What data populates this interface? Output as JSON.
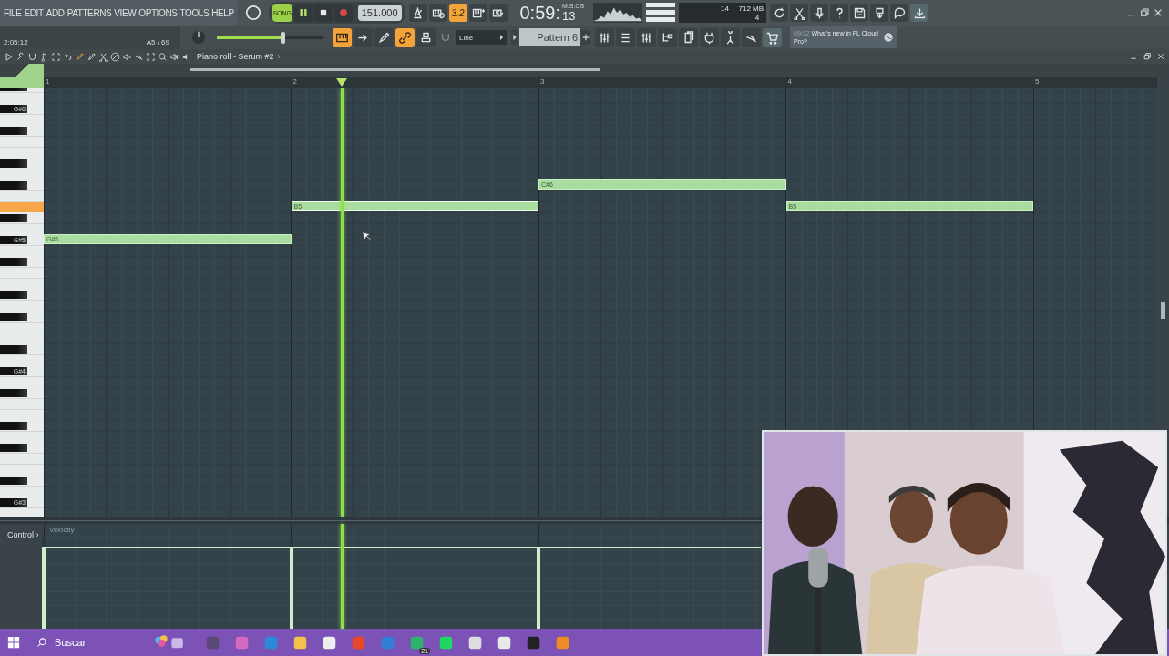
{
  "menu": [
    "FILE",
    "EDIT",
    "ADD",
    "PATTERNS",
    "VIEW",
    "OPTIONS",
    "TOOLS",
    "HELP"
  ],
  "transport": {
    "song": {
      "label": "SONG",
      "selected": true
    },
    "playing": true,
    "recording": false,
    "tempo": "151.000",
    "time": "0:59:",
    "time_cs": "13",
    "time_unit": "M:S:CS"
  },
  "toggles": [
    {
      "kind": "metronome",
      "on": false
    },
    {
      "kind": "wait",
      "on": false
    },
    {
      "kind": "countdown",
      "label": "3.2",
      "on": true
    },
    {
      "kind": "step",
      "on": false
    },
    {
      "kind": "loop",
      "on": false
    }
  ],
  "monitor": {
    "cpu": "14",
    "ram": "712 MB",
    "polyphony": "4"
  },
  "hint_bar": {
    "position": "2:05:12",
    "key": "A5 / 69"
  },
  "master_volume": {
    "level": 0.62
  },
  "tools": [
    {
      "kind": "piano",
      "on": true
    },
    {
      "kind": "arrow",
      "on": false
    },
    {
      "kind": "pencil",
      "on": false
    },
    {
      "kind": "link",
      "on": true
    },
    {
      "kind": "stamp",
      "on": false
    }
  ],
  "snap": {
    "value": "Line"
  },
  "pattern": {
    "value": "Pattern 6"
  },
  "news": {
    "date": "09/12",
    "text": "What's new in FL Cloud Pro?"
  },
  "piano_roll": {
    "title": "Piano roll - Serum #2",
    "key_labels": [
      "G#6",
      "G#5",
      "G#4",
      "G#3"
    ],
    "playhead": {
      "level": 0.268
    },
    "bars": [
      {
        "label": "1",
        "notes": [
          {
            "label": "G#5",
            "playing": false,
            "level": 0.9
          }
        ]
      },
      {
        "label": "2",
        "notes": [
          {
            "label": "B5",
            "playing": true,
            "level": 0.9
          }
        ]
      },
      {
        "label": "3",
        "notes": [
          {
            "label": "C#6",
            "playing": false,
            "level": 0.9
          }
        ]
      },
      {
        "label": "4",
        "notes": [
          {
            "label": "B5",
            "playing": false
          }
        ]
      },
      {
        "label": "5"
      }
    ],
    "control": {
      "label": "Control",
      "arrow": "›",
      "parameter": "Velocity"
    }
  },
  "taskbar": {
    "search": {
      "placeholder": "Buscar"
    },
    "badge": "21"
  }
}
